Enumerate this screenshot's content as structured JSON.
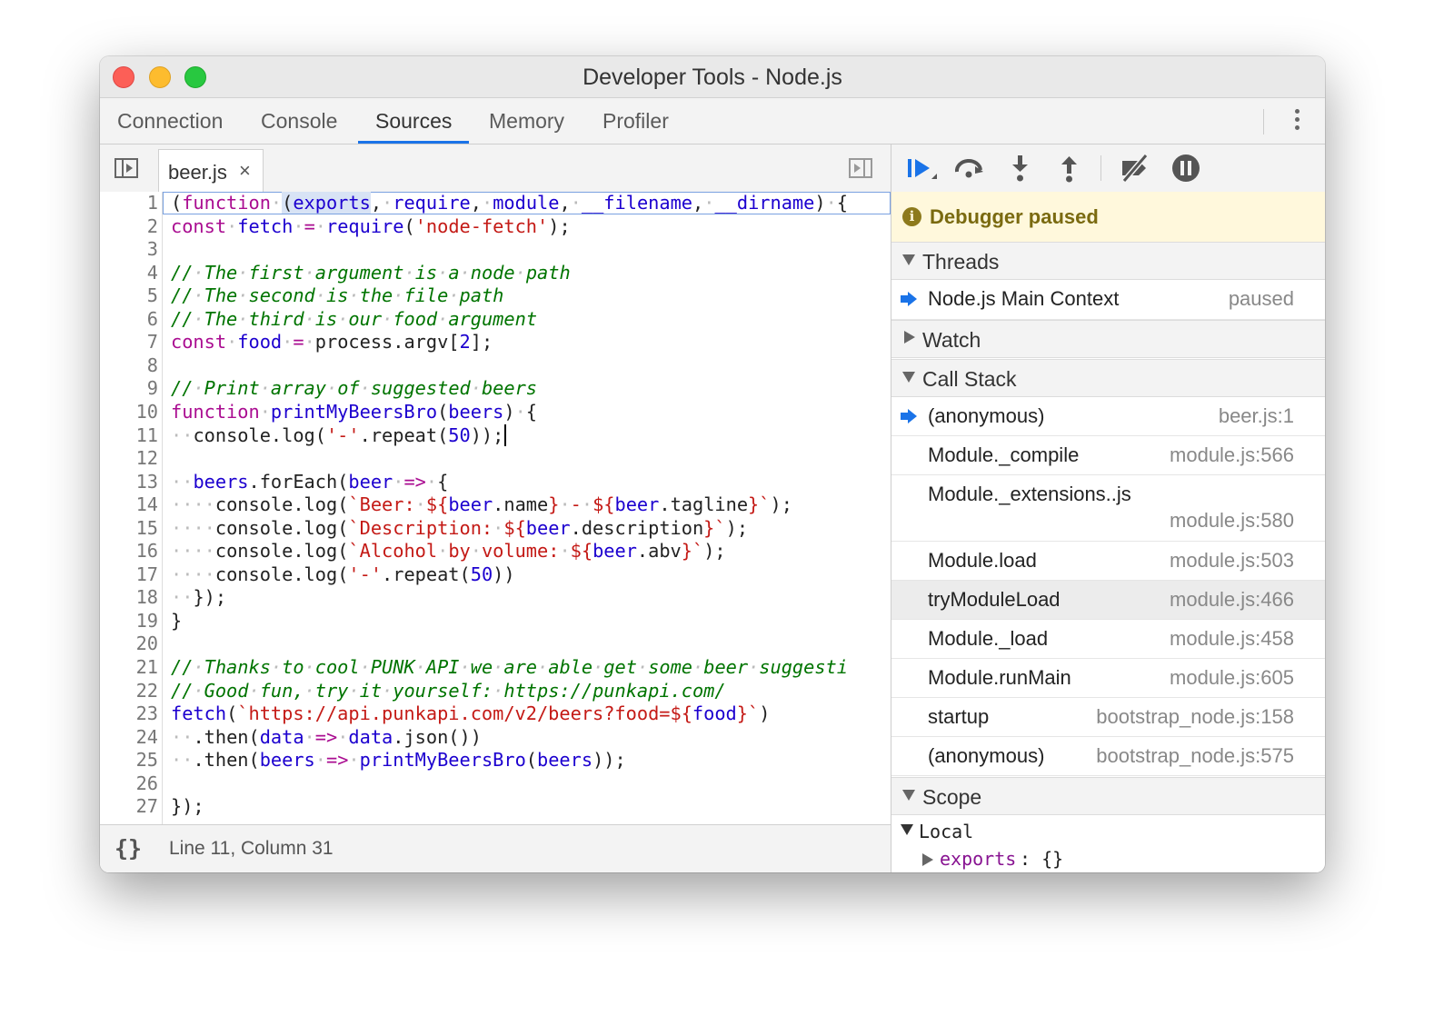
{
  "window": {
    "title": "Developer Tools - Node.js"
  },
  "tabs": [
    "Connection",
    "Console",
    "Sources",
    "Memory",
    "Profiler"
  ],
  "active_tab": "Sources",
  "file_tab": {
    "name": "beer.js",
    "close": "×"
  },
  "code_lines": [
    "(function (exports, require, module, __filename, __dirname) {",
    "const fetch = require('node-fetch');",
    "",
    "// The first argument is a node path",
    "// The second is the file path",
    "// The third is our food argument",
    "const food = process.argv[2];",
    "",
    "// Print array of suggested beers",
    "function printMyBeersBro(beers) {",
    "  console.log('-'.repeat(50));",
    "",
    "  beers.forEach(beer => {",
    "    console.log(`Beer: ${beer.name} - ${beer.tagline}`);",
    "    console.log(`Description: ${beer.description}`);",
    "    console.log(`Alcohol by volume: ${beer.abv}`);",
    "    console.log('-'.repeat(50))",
    "  });",
    "}",
    "",
    "// Thanks to cool PUNK API we are able get some beer suggesti",
    "// Good fun, try it yourself: https://punkapi.com/",
    "fetch(`https://api.punkapi.com/v2/beers?food=${food}`)",
    "  .then(data => data.json())",
    "  .then(beers => printMyBeersBro(beers));",
    "",
    "});"
  ],
  "status": {
    "braces": "{}",
    "position": "Line 11, Column 31"
  },
  "debugger": {
    "paused_text": "Debugger paused",
    "paused_icon": "i",
    "threads_label": "Threads",
    "thread": {
      "name": "Node.js Main Context",
      "state": "paused"
    },
    "watch_label": "Watch",
    "callstack_label": "Call Stack",
    "frames": [
      {
        "name": "(anonymous)",
        "loc": "beer.js:1"
      },
      {
        "name": "Module._compile",
        "loc": "module.js:566"
      },
      {
        "name": "Module._extensions..js",
        "loc": "module.js:580"
      },
      {
        "name": "Module.load",
        "loc": "module.js:503"
      },
      {
        "name": "tryModuleLoad",
        "loc": "module.js:466"
      },
      {
        "name": "Module._load",
        "loc": "module.js:458"
      },
      {
        "name": "Module.runMain",
        "loc": "module.js:605"
      },
      {
        "name": "startup",
        "loc": "bootstrap_node.js:158"
      },
      {
        "name": "(anonymous)",
        "loc": "bootstrap_node.js:575"
      }
    ],
    "scope_label": "Scope",
    "local_label": "Local",
    "exports_key": "exports",
    "exports_value": ": {}"
  },
  "colors": {
    "accent": "#1a73e8",
    "paused_bg": "#fff8dc",
    "keyword": "#aa0d91",
    "string": "#c41a16",
    "comment": "#007400"
  }
}
